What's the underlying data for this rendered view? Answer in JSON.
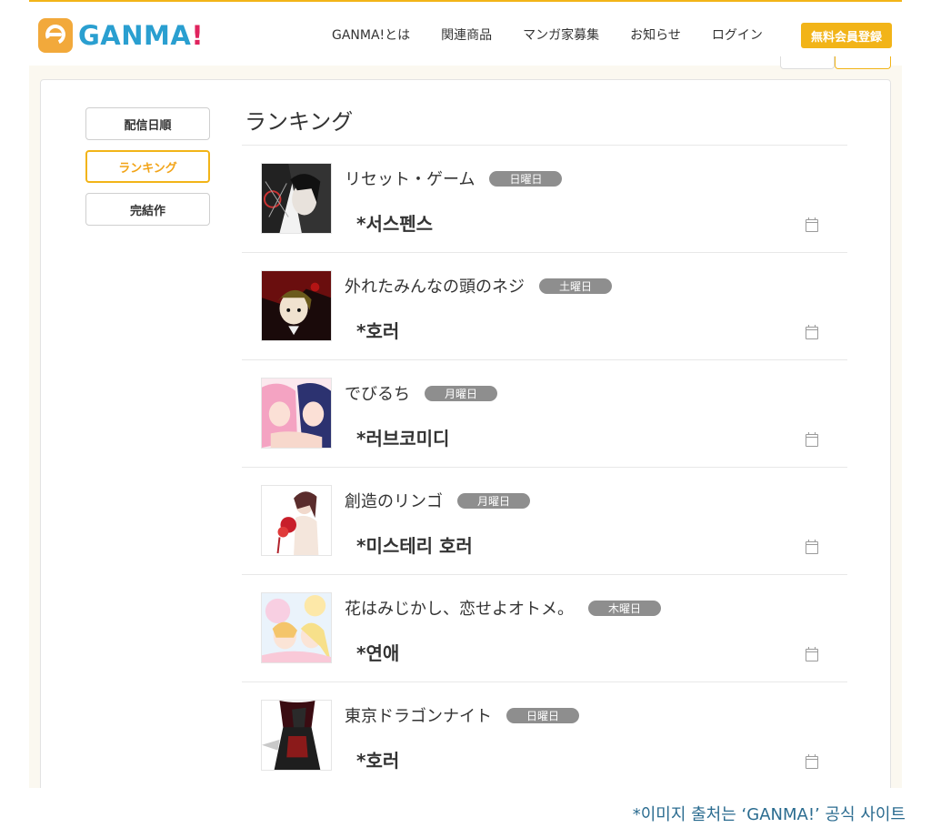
{
  "header": {
    "logo_text": "GANMA",
    "logo_bang": "!",
    "nav": [
      "GANMA!とは",
      "関連商品",
      "マンガ家募集",
      "お知らせ",
      "ログイン"
    ],
    "signup_label": "無料会員登録"
  },
  "sidebar": {
    "items": [
      {
        "label": "配信日順",
        "active": false
      },
      {
        "label": "ランキング",
        "active": true
      },
      {
        "label": "完結作",
        "active": false
      }
    ]
  },
  "main": {
    "title": "ランキング",
    "rows": [
      {
        "title": "リセット・ゲーム",
        "day": "日曜日",
        "genre": "*서스펜스",
        "thumb": "dark-manga-cover"
      },
      {
        "title": "外れたみんなの頭のネジ",
        "day": "土曜日",
        "genre": "*호러",
        "thumb": "red-dark-manga-cover"
      },
      {
        "title": "でびるち",
        "day": "月曜日",
        "genre": "*러브코미디",
        "thumb": "pink-blue-manga-cover"
      },
      {
        "title": "創造のリンゴ",
        "day": "月曜日",
        "genre": "*미스테리 호러",
        "thumb": "red-flower-manga-cover"
      },
      {
        "title": "花はみじかし、恋せよオトメ。",
        "day": "木曜日",
        "genre": "*연애",
        "thumb": "pastel-manga-cover"
      },
      {
        "title": "東京ドラゴンナイト",
        "day": "日曜日",
        "genre": "*호러",
        "thumb": "dark-red-manga-cover"
      }
    ]
  },
  "source_note": "*이미지 출처는 ‘GANMA!’ 공식 사이트",
  "colors": {
    "accent": "#f2b418",
    "logo_blue": "#2a9fd0",
    "badge_gray": "#8e8e8e",
    "source_text": "#2b6c90"
  }
}
